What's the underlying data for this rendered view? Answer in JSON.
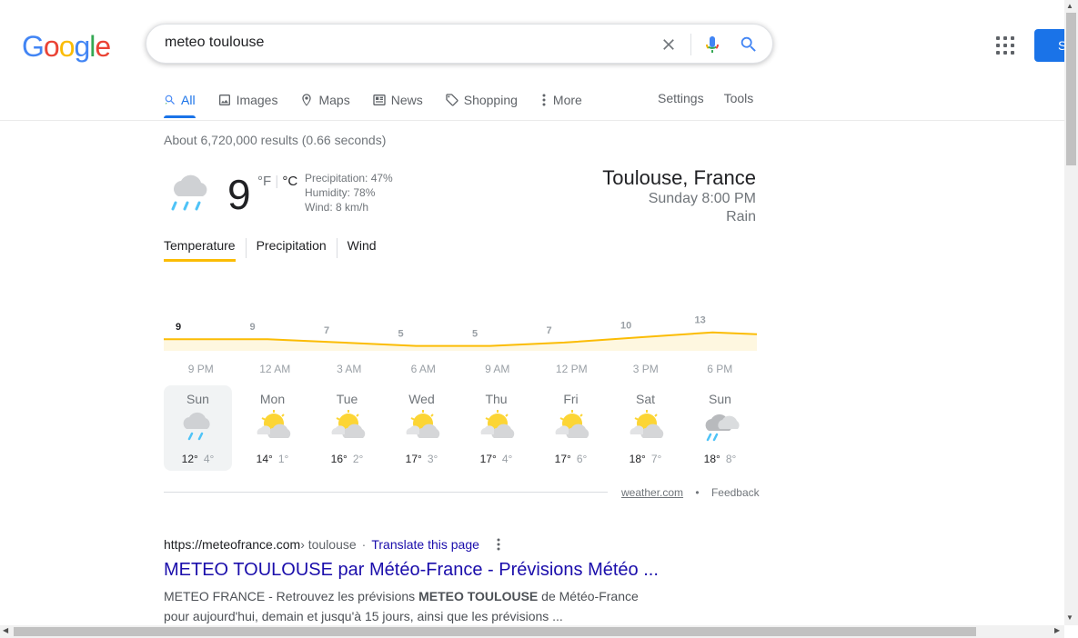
{
  "search": {
    "query": "meteo toulouse"
  },
  "header": {
    "signin_label": "S"
  },
  "tabs": [
    {
      "label": "All",
      "icon": "search-icon"
    },
    {
      "label": "Images",
      "icon": "image-icon"
    },
    {
      "label": "Maps",
      "icon": "map-pin-icon"
    },
    {
      "label": "News",
      "icon": "news-icon"
    },
    {
      "label": "Shopping",
      "icon": "tag-icon"
    },
    {
      "label": "More",
      "icon": "more-vert-icon"
    }
  ],
  "tools": {
    "settings": "Settings",
    "tools": "Tools"
  },
  "stats": "About 6,720,000 results (0.66 seconds)",
  "weather": {
    "temp": "9",
    "unit_f": "°F",
    "unit_c": "°C",
    "precipitation": "Precipitation: 47%",
    "humidity": "Humidity: 78%",
    "wind": "Wind: 8 km/h",
    "location": "Toulouse, France",
    "datetime": "Sunday 8:00 PM",
    "condition": "Rain",
    "tabs": [
      "Temperature",
      "Precipitation",
      "Wind"
    ],
    "source": "weather.com",
    "feedback": "Feedback",
    "days": [
      {
        "name": "Sun",
        "hi": "12°",
        "lo": "4°",
        "icon": "rain-icon"
      },
      {
        "name": "Mon",
        "hi": "14°",
        "lo": "1°",
        "icon": "partly-cloudy-icon"
      },
      {
        "name": "Tue",
        "hi": "16°",
        "lo": "2°",
        "icon": "partly-cloudy-icon"
      },
      {
        "name": "Wed",
        "hi": "17°",
        "lo": "3°",
        "icon": "partly-cloudy-icon"
      },
      {
        "name": "Thu",
        "hi": "17°",
        "lo": "4°",
        "icon": "partly-cloudy-icon"
      },
      {
        "name": "Fri",
        "hi": "17°",
        "lo": "6°",
        "icon": "partly-cloudy-icon"
      },
      {
        "name": "Sat",
        "hi": "18°",
        "lo": "7°",
        "icon": "partly-cloudy-icon"
      },
      {
        "name": "Sun",
        "hi": "18°",
        "lo": "8°",
        "icon": "rain-cloud-icon"
      }
    ]
  },
  "chart_data": {
    "type": "area",
    "x": [
      "9 PM",
      "12 AM",
      "3 AM",
      "6 AM",
      "9 AM",
      "12 PM",
      "3 PM",
      "6 PM"
    ],
    "series": [
      {
        "values": [
          9,
          9,
          7,
          5,
          5,
          7,
          10,
          13
        ]
      }
    ],
    "color": "#fbbc04",
    "fill": "#fef7e0"
  },
  "result": {
    "url": "https://meteofrance.com",
    "crumb": " › toulouse",
    "translate": "Translate this page",
    "title": "METEO TOULOUSE par Météo-France - Prévisions Météo ...",
    "snippet_pre": "METEO FRANCE - Retrouvez les prévisions ",
    "snippet_bold": "METEO TOULOUSE",
    "snippet_post": " de Météo-France pour aujourd'hui, demain et jusqu'à 15 jours, ainsi que les prévisions ..."
  },
  "colors": {
    "accent": "#1a73e8",
    "link": "#1a0dab",
    "sun": "#fbbc04"
  }
}
